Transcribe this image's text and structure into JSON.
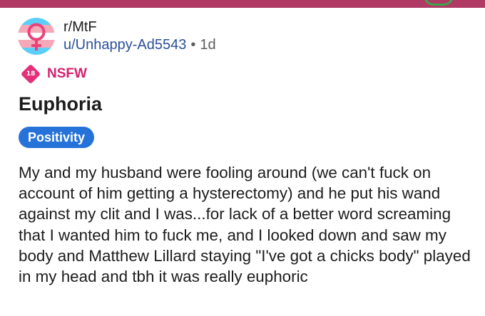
{
  "post": {
    "subreddit": "r/MtF",
    "author": "u/Unhappy-Ad5543",
    "separator": "•",
    "age": "1d",
    "nsfw_badge": "18",
    "nsfw_label": "NSFW",
    "title": "Euphoria",
    "flair": "Positivity",
    "body": "My and my husband were fooling around (we can't fuck on account of him getting a hysterectomy) and he put his wand against my clit and I was...for lack of a better word screaming that I wanted him to fuck me, and I looked down and saw my body and Matthew Lillard staying \"I've got a chicks body\" played in my head and tbh it was really euphoric"
  },
  "icons": {
    "avatar": "transgender-flag-female-symbol-icon",
    "nsfw": "nsfw-18-diamond-icon"
  },
  "colors": {
    "top_bar": "#b03a64",
    "author_link": "#2b4f9b",
    "nsfw": "#d6206f",
    "flair_bg": "#2573d9",
    "flag_blue": "#5bcefa",
    "flag_pink": "#f5a9b8",
    "symbol": "#e8437a"
  }
}
